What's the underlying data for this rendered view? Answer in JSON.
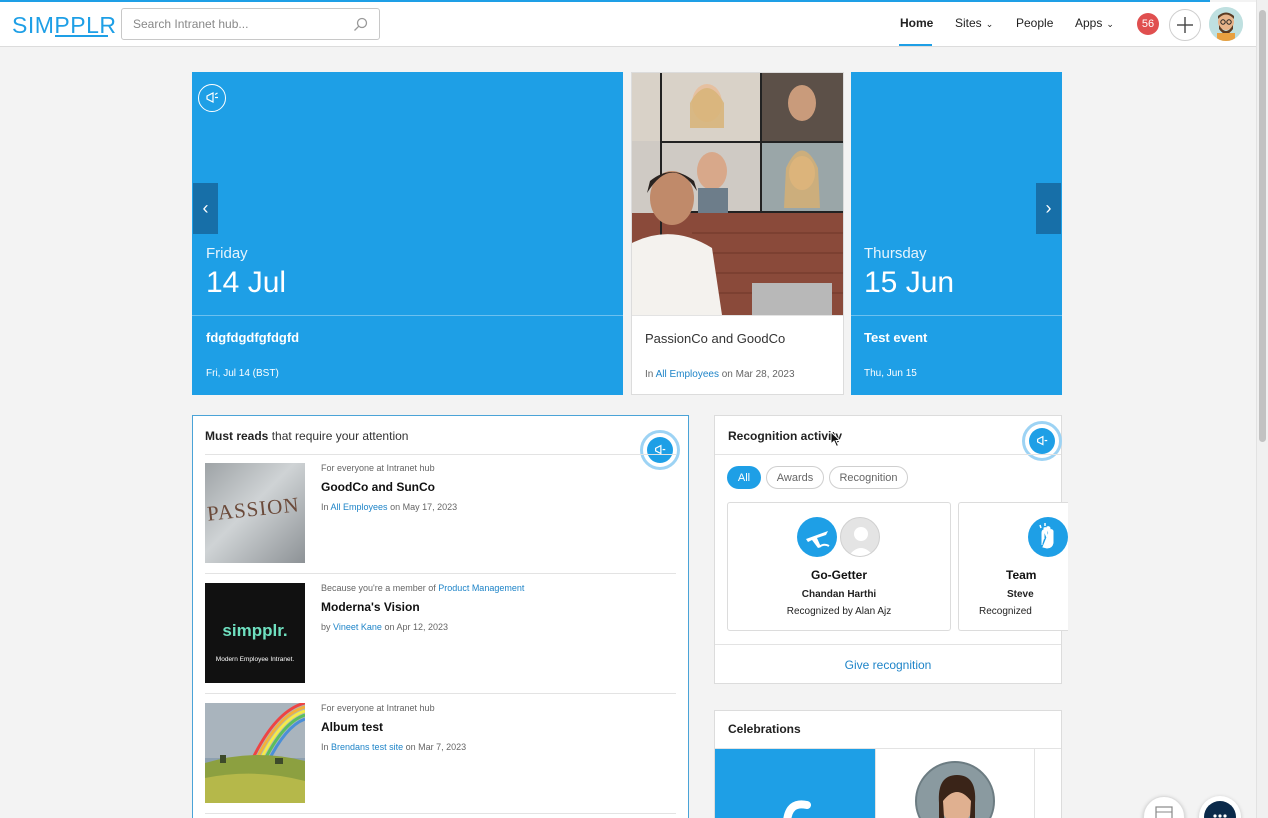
{
  "header": {
    "logo": "SIMPPLR",
    "search_placeholder": "Search Intranet hub...",
    "nav": {
      "home": "Home",
      "sites": "Sites",
      "people": "People",
      "apps": "Apps"
    },
    "notification_count": "56"
  },
  "carousel": [
    {
      "day": "Friday",
      "date": "14 Jul",
      "title": "fdgfdgdfgfdgfd",
      "sub": "Fri, Jul 14 (BST)"
    },
    {
      "title": "PassionCo and GoodCo",
      "sub_prefix": "In",
      "sub_link": "All Employees",
      "sub_suffix": "on Mar 28, 2023"
    },
    {
      "day": "Thursday",
      "date": "15 Jun",
      "title": "Test event",
      "sub": "Thu, Jun 15"
    }
  ],
  "must_reads": {
    "heading_bold": "Must reads",
    "heading_rest": "that require your attention",
    "items": [
      {
        "meta": "For everyone at Intranet hub",
        "meta_link": "",
        "title": "GoodCo and SunCo",
        "by_prefix": "In",
        "by_link": "All Employees",
        "by_suffix": "on May 17, 2023",
        "thumb_text": "PASSION"
      },
      {
        "meta": "Because you're a member of",
        "meta_link": "Product Management",
        "title": "Moderna's Vision",
        "by_prefix": "by",
        "by_link": "Vineet Kane",
        "by_suffix": "on Apr 12, 2023",
        "thumb_text": "simpplr.",
        "thumb_sub": "Modern Employee Intranet."
      },
      {
        "meta": "For everyone at Intranet hub",
        "meta_link": "",
        "title": "Album test",
        "by_prefix": "In",
        "by_link": "Brendans test site",
        "by_suffix": "on Mar 7, 2023"
      }
    ]
  },
  "recognition": {
    "title": "Recognition activity",
    "filters": [
      "All",
      "Awards",
      "Recognition"
    ],
    "cards": [
      {
        "award": "Go-Getter",
        "person": "Chandan Harthi",
        "by": "Recognized by Alan Ajz"
      },
      {
        "award": "Team",
        "person": "Steve",
        "by": "Recognized"
      }
    ],
    "give_label": "Give recognition"
  },
  "celebrations": {
    "title": "Celebrations"
  },
  "colors": {
    "accent": "#1e9fe6",
    "link": "#1e84c8",
    "badge": "#e04f4f"
  }
}
